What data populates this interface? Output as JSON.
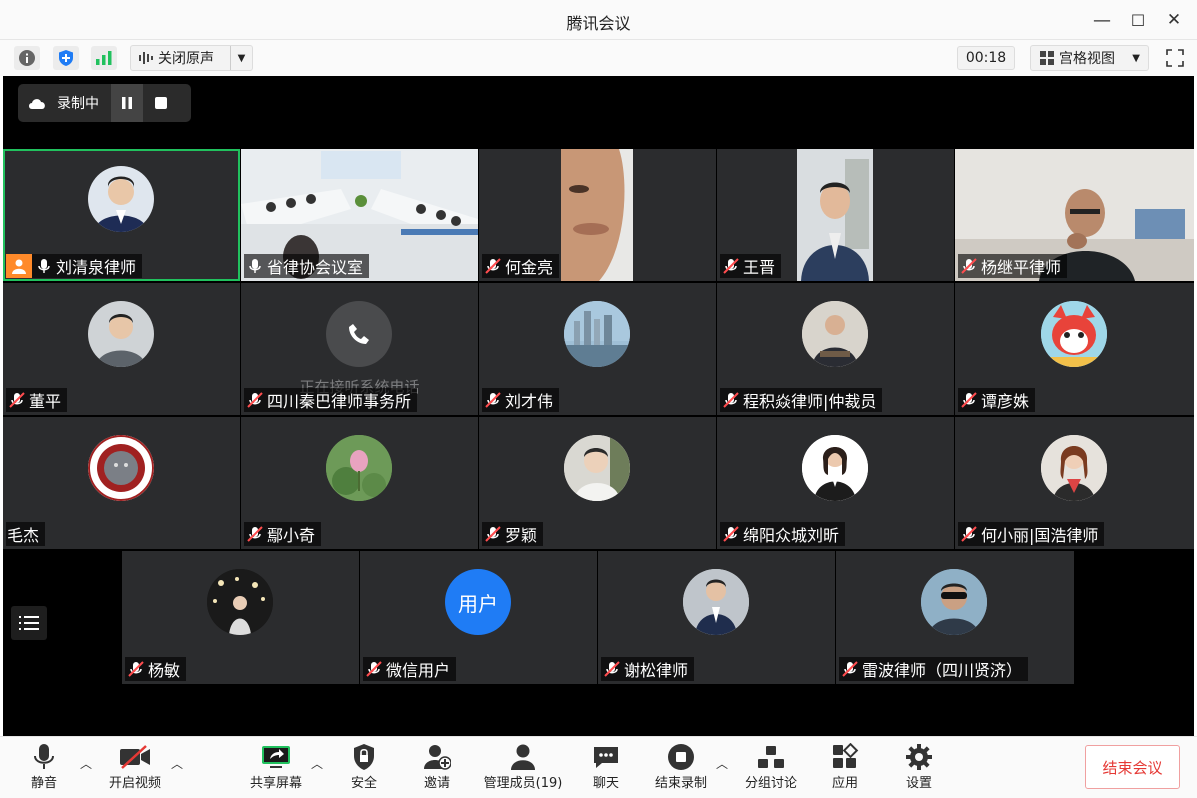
{
  "window": {
    "title": "腾讯会议",
    "minimize": "—",
    "maximize": "☐",
    "close": "✕"
  },
  "toolbar": {
    "noise_label": "关闭原声",
    "timer": "00:18",
    "view_label": "宫格视图"
  },
  "recording": {
    "label": "录制中"
  },
  "participants": [
    {
      "name": "刘清泉律师",
      "muted": false,
      "host": true,
      "active": true,
      "avatar": "portrait-blue"
    },
    {
      "name": "省律协会议室",
      "muted": false,
      "video": "conference-room"
    },
    {
      "name": "何金亮",
      "muted": true,
      "video": "face-closeup"
    },
    {
      "name": "王晋",
      "muted": true,
      "video": "man-suit-office"
    },
    {
      "name": "杨继平律师",
      "muted": true,
      "video": "man-room"
    },
    {
      "name": "董平",
      "muted": true,
      "avatar": "portrait-grey"
    },
    {
      "name": "四川秦巴律师事务所",
      "muted": true,
      "avatar": "phone-icon",
      "status_text": "正在接听系统电话"
    },
    {
      "name": "刘才伟",
      "muted": true,
      "avatar": "city-skyline"
    },
    {
      "name": "程积焱律师|仲裁员",
      "muted": true,
      "avatar": "portrait-office"
    },
    {
      "name": "谭彦姝",
      "muted": true,
      "avatar": "cartoon-fox"
    },
    {
      "name": "毛杰",
      "muted": null,
      "avatar": "university-seal"
    },
    {
      "name": "鄢小奇",
      "muted": true,
      "avatar": "lotus"
    },
    {
      "name": "罗颖",
      "muted": true,
      "avatar": "portrait-white"
    },
    {
      "name": "绵阳众城刘昕",
      "muted": true,
      "avatar": "woman-suit"
    },
    {
      "name": "何小丽|国浩律师",
      "muted": true,
      "avatar": "woman-portrait"
    },
    {
      "name": "杨敏",
      "muted": true,
      "avatar": "night-lights"
    },
    {
      "name": "微信用户",
      "muted": true,
      "avatar": "text-avatar",
      "avatar_text": "用户"
    },
    {
      "name": "谢松律师",
      "muted": true,
      "avatar": "man-suit-grey"
    },
    {
      "name": "雷波律师（四川贤济）",
      "muted": true,
      "avatar": "man-sunglasses"
    }
  ],
  "bottom_bar": {
    "mute": "静音",
    "video": "开启视频",
    "share": "共享屏幕",
    "security": "安全",
    "invite": "邀请",
    "members": "管理成员(19)",
    "chat": "聊天",
    "stop_record": "结束录制",
    "breakout": "分组讨论",
    "apps": "应用",
    "settings": "设置",
    "end": "结束会议"
  },
  "colors": {
    "accent": "#21c15e",
    "end": "#e53935",
    "user_avatar": "#1f7cf5",
    "host_badge": "#ff8a2a"
  }
}
